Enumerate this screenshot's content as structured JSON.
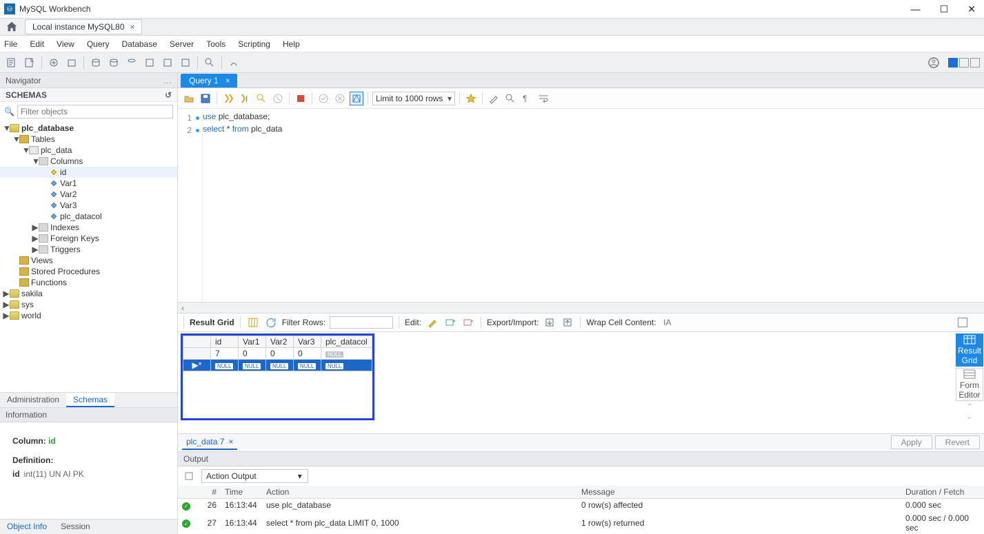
{
  "window": {
    "title": "MySQL Workbench"
  },
  "connection_tab": "Local instance MySQL80",
  "menu": [
    "File",
    "Edit",
    "View",
    "Query",
    "Database",
    "Server",
    "Tools",
    "Scripting",
    "Help"
  ],
  "navigator": {
    "title": "Navigator",
    "panel": "SCHEMAS",
    "filter_placeholder": "Filter objects"
  },
  "tree": {
    "db": "plc_database",
    "tables": "Tables",
    "table": "plc_data",
    "columns": "Columns",
    "cols": [
      "id",
      "Var1",
      "Var2",
      "Var3",
      "plc_datacol"
    ],
    "indexes": "Indexes",
    "fk": "Foreign Keys",
    "trig": "Triggers",
    "views": "Views",
    "sp": "Stored Procedures",
    "fn": "Functions",
    "others": [
      "sakila",
      "sys",
      "world"
    ]
  },
  "nav_tabs": {
    "admin": "Administration",
    "schemas": "Schemas"
  },
  "info": {
    "title": "Information",
    "column_label": "Column:",
    "column": "id",
    "def_label": "Definition:",
    "def_key": "id",
    "def_val": "int(11) UN AI PK"
  },
  "bottom_tabs": {
    "obj": "Object Info",
    "sess": "Session"
  },
  "query_tab": "Query 1",
  "limit": "Limit to 1000 rows",
  "code": {
    "l1": {
      "kw": "use",
      "rest": " plc_database;"
    },
    "l2": {
      "kw1": "select",
      "mid": " * ",
      "kw2": "from",
      "rest": " plc_data"
    }
  },
  "result_bar": {
    "grid": "Result Grid",
    "filter": "Filter Rows:",
    "edit": "Edit:",
    "ei": "Export/Import:",
    "wrap": "Wrap Cell Content:"
  },
  "grid": {
    "headers": [
      "id",
      "Var1",
      "Var2",
      "Var3",
      "plc_datacol"
    ],
    "rows": [
      {
        "h": "",
        "cells": [
          "7",
          "0",
          "0",
          "0",
          "NULL"
        ],
        "nulls": [
          false,
          false,
          false,
          false,
          true
        ],
        "selected": false
      },
      {
        "h": "▶*",
        "cells": [
          "NULL",
          "NULL",
          "NULL",
          "NULL",
          "NULL"
        ],
        "nulls": [
          true,
          true,
          true,
          true,
          true
        ],
        "selected": true
      }
    ]
  },
  "side": {
    "rg": "Result\nGrid",
    "fe": "Form\nEditor"
  },
  "result_tab": "plc_data 7",
  "result_btns": {
    "apply": "Apply",
    "revert": "Revert"
  },
  "output": {
    "title": "Output",
    "mode": "Action Output",
    "cols": [
      "",
      "#",
      "Time",
      "Action",
      "Message",
      "Duration / Fetch"
    ],
    "rows": [
      {
        "n": "26",
        "t": "16:13:44",
        "a": "use plc_database",
        "m": "0 row(s) affected",
        "d": "0.000 sec"
      },
      {
        "n": "27",
        "t": "16:13:44",
        "a": "select * from plc_data LIMIT 0, 1000",
        "m": "1 row(s) returned",
        "d": "0.000 sec / 0.000 sec"
      }
    ]
  }
}
